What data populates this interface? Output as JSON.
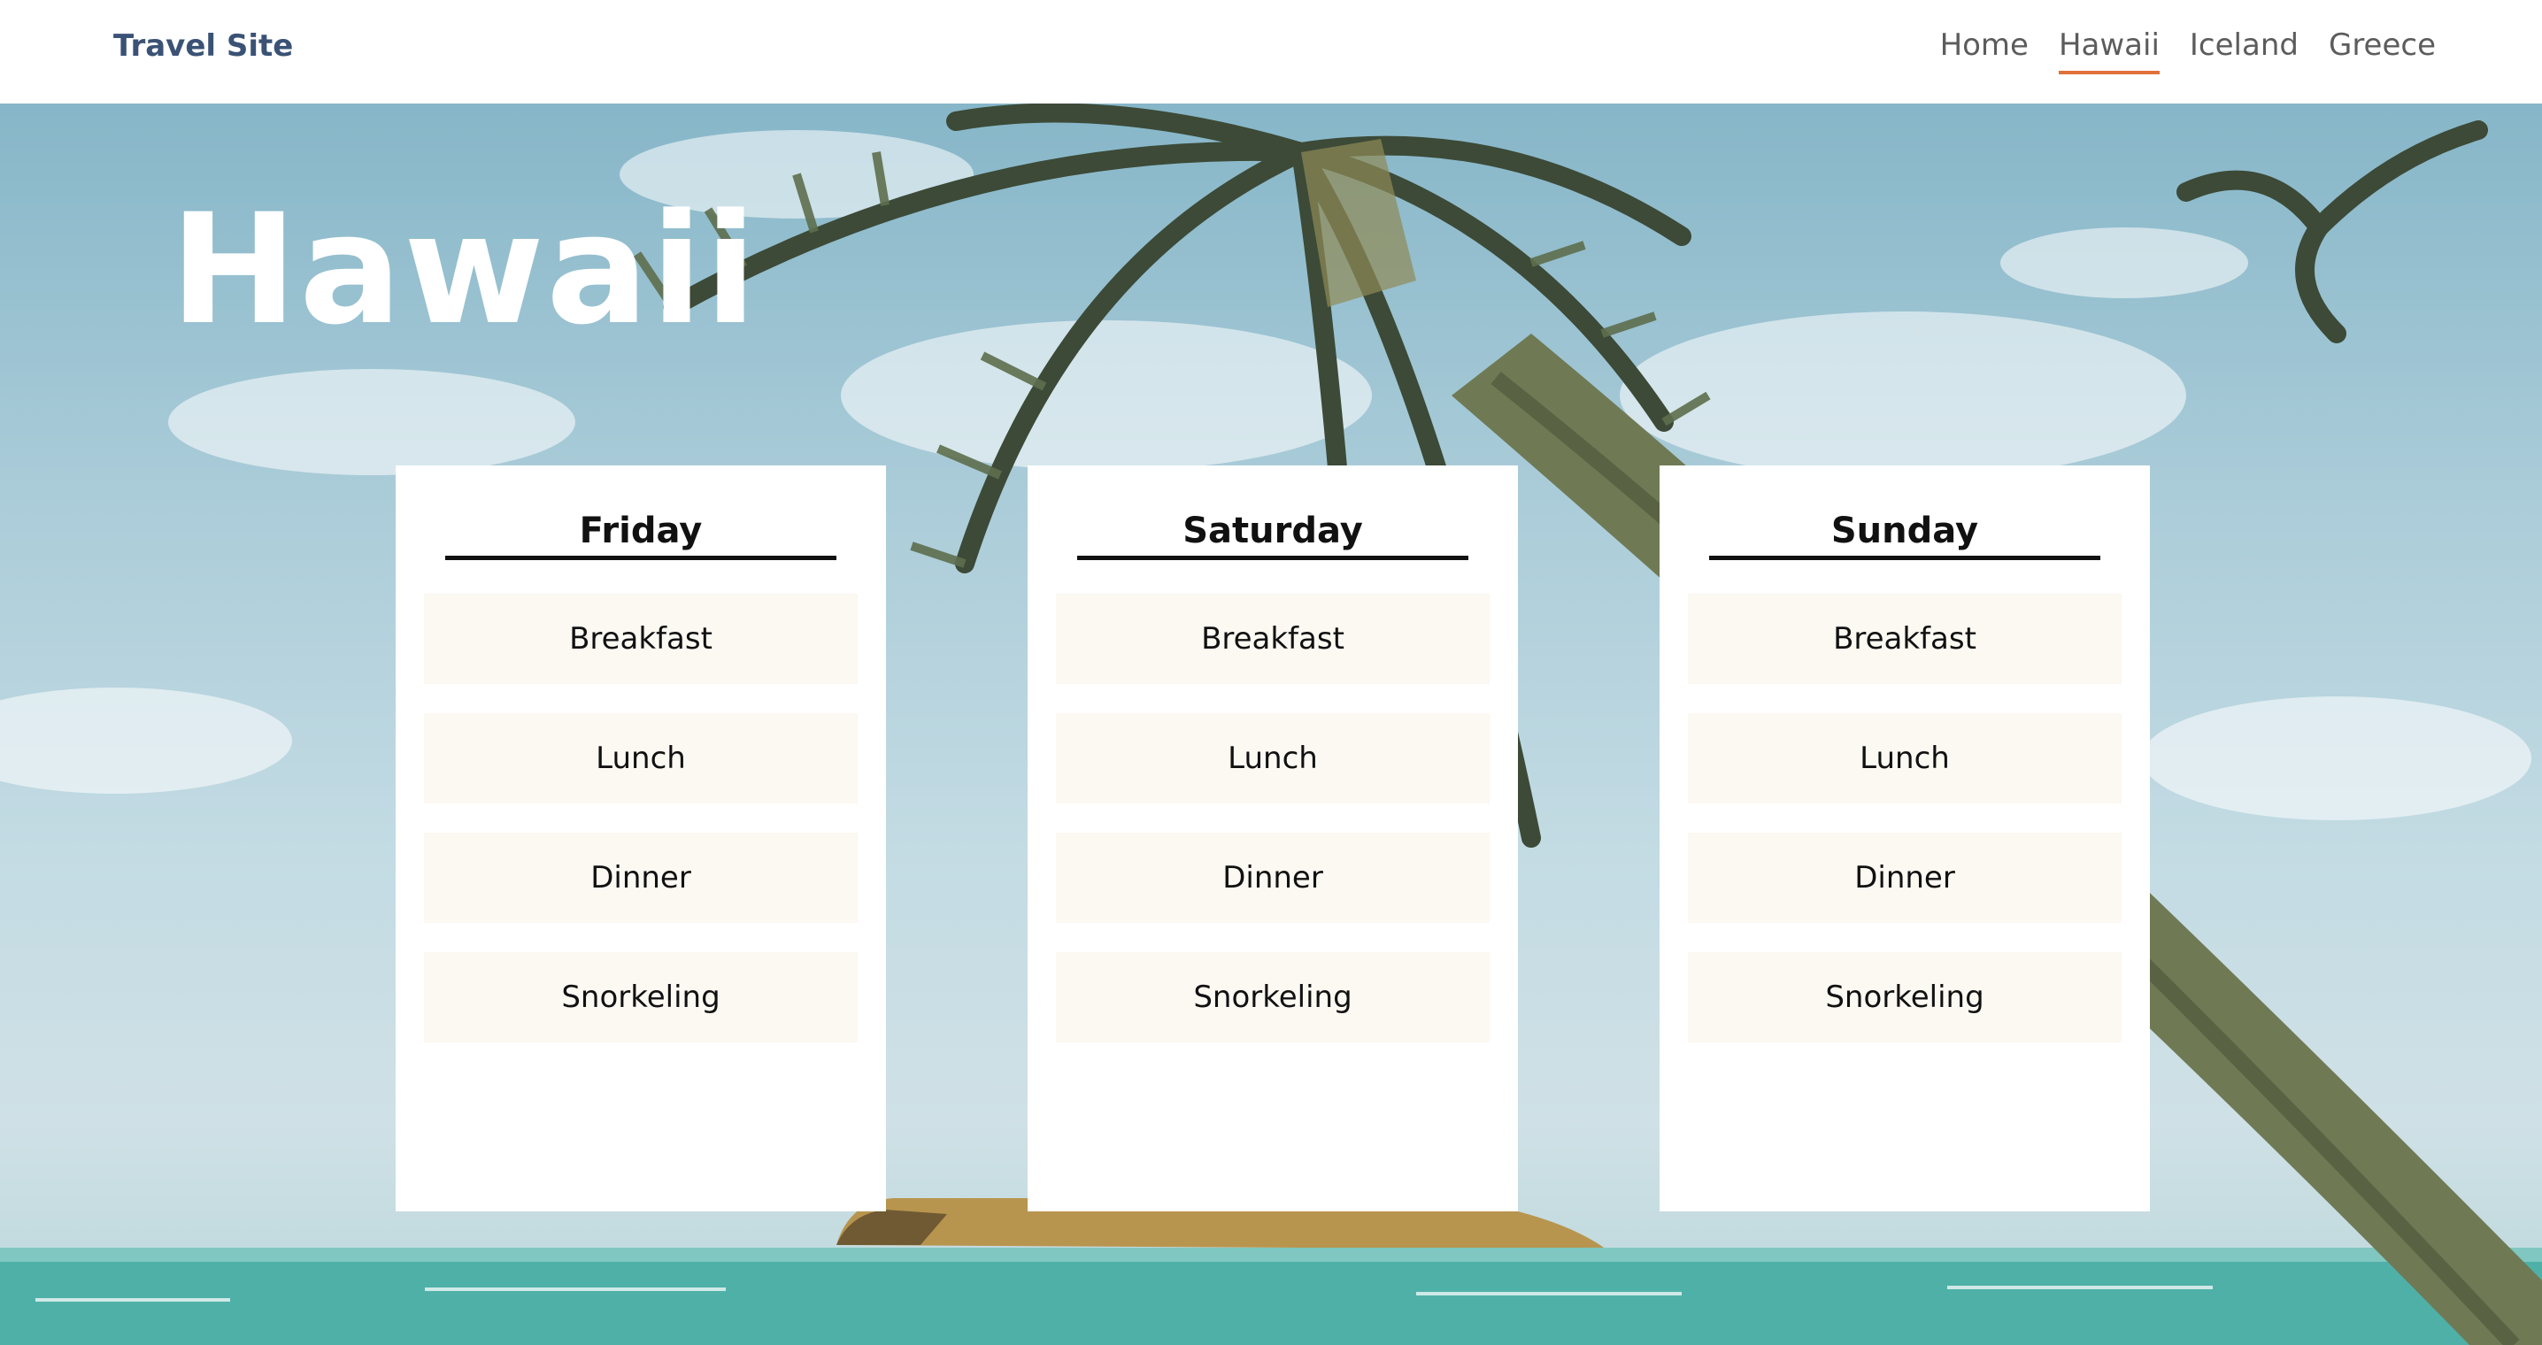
{
  "site": {
    "brand": "Travel Site"
  },
  "nav": {
    "items": [
      {
        "label": "Home",
        "active": false
      },
      {
        "label": "Hawaii",
        "active": true
      },
      {
        "label": "Iceland",
        "active": false
      },
      {
        "label": "Greece",
        "active": false
      }
    ],
    "accent_color": "#e0713a"
  },
  "hero": {
    "title": "Hawaii",
    "background": "palm-tree-beach-photo"
  },
  "days": [
    {
      "name": "Friday",
      "activities": [
        "Breakfast",
        "Lunch",
        "Dinner",
        "Snorkeling"
      ]
    },
    {
      "name": "Saturday",
      "activities": [
        "Breakfast",
        "Lunch",
        "Dinner",
        "Snorkeling"
      ]
    },
    {
      "name": "Sunday",
      "activities": [
        "Breakfast",
        "Lunch",
        "Dinner",
        "Snorkeling"
      ]
    }
  ]
}
